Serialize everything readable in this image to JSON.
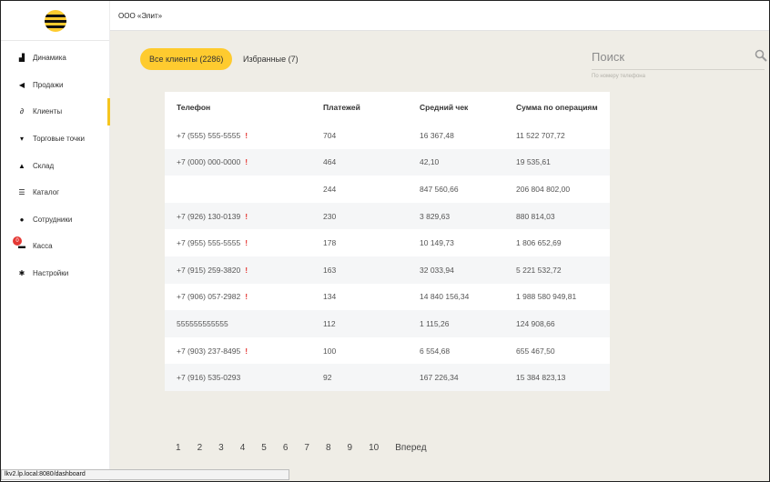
{
  "company": "ООО «Элит»",
  "menu": [
    {
      "label": "Динамика",
      "icon": "bar-chart-icon",
      "glyph": "▟"
    },
    {
      "label": "Продажи",
      "icon": "send-icon",
      "glyph": "◀"
    },
    {
      "label": "Клиенты",
      "icon": "link-icon",
      "glyph": "∂"
    },
    {
      "label": "Торговые точки",
      "icon": "cart-icon",
      "glyph": "▾"
    },
    {
      "label": "Склад",
      "icon": "home-icon",
      "glyph": "▲"
    },
    {
      "label": "Каталог",
      "icon": "list-icon",
      "glyph": "☰"
    },
    {
      "label": "Сотрудники",
      "icon": "user-icon",
      "glyph": "●"
    },
    {
      "label": "Касса",
      "icon": "cashbox-icon",
      "glyph": "▬",
      "badge": "0"
    },
    {
      "label": "Настройки",
      "icon": "gear-icon",
      "glyph": "✱"
    }
  ],
  "tabs": {
    "all": "Все клиенты (2286)",
    "favorites": "Избранные (7)"
  },
  "search": {
    "label": "Поиск",
    "hint": "По номеру телефона"
  },
  "table": {
    "headers": [
      "Телефон",
      "Платежей",
      "Средний чек",
      "Сумма по операциям"
    ],
    "rows": [
      {
        "phone": "+7 (555) 555-5555",
        "warn": "!",
        "payments": "704",
        "avg": "16 367,48",
        "sum": "11 522 707,72"
      },
      {
        "phone": "+7 (000) 000-0000",
        "warn": "!",
        "payments": "464",
        "avg": "42,10",
        "sum": "19 535,61"
      },
      {
        "phone": "",
        "warn": "",
        "payments": "244",
        "avg": "847 560,66",
        "sum": "206 804 802,00"
      },
      {
        "phone": "+7 (926) 130-0139",
        "warn": "!",
        "payments": "230",
        "avg": "3 829,63",
        "sum": "880 814,03"
      },
      {
        "phone": "+7 (955) 555-5555",
        "warn": "!",
        "payments": "178",
        "avg": "10 149,73",
        "sum": "1 806 652,69"
      },
      {
        "phone": "+7 (915) 259-3820",
        "warn": "!",
        "payments": "163",
        "avg": "32 033,94",
        "sum": "5 221 532,72"
      },
      {
        "phone": "+7 (906) 057-2982",
        "warn": "!",
        "payments": "134",
        "avg": "14 840 156,34",
        "sum": "1 988 580 949,81"
      },
      {
        "phone": "555555555555",
        "warn": "",
        "payments": "112",
        "avg": "1 115,26",
        "sum": "124 908,66"
      },
      {
        "phone": "+7 (903) 237-8495",
        "warn": "!",
        "payments": "100",
        "avg": "6 554,68",
        "sum": "655 467,50"
      },
      {
        "phone": "+7 (916) 535-0293",
        "warn": "",
        "payments": "92",
        "avg": "167 226,34",
        "sum": "15 384 823,13"
      }
    ]
  },
  "pagination": {
    "pages": [
      "1",
      "2",
      "3",
      "4",
      "5",
      "6",
      "7",
      "8",
      "9",
      "10"
    ],
    "next": "Вперед"
  },
  "status_url": "lkv2.lp.local:8080/dashboard",
  "colors": {
    "accent": "#fecb2f",
    "warn": "#e53935",
    "background": "#efede6"
  }
}
